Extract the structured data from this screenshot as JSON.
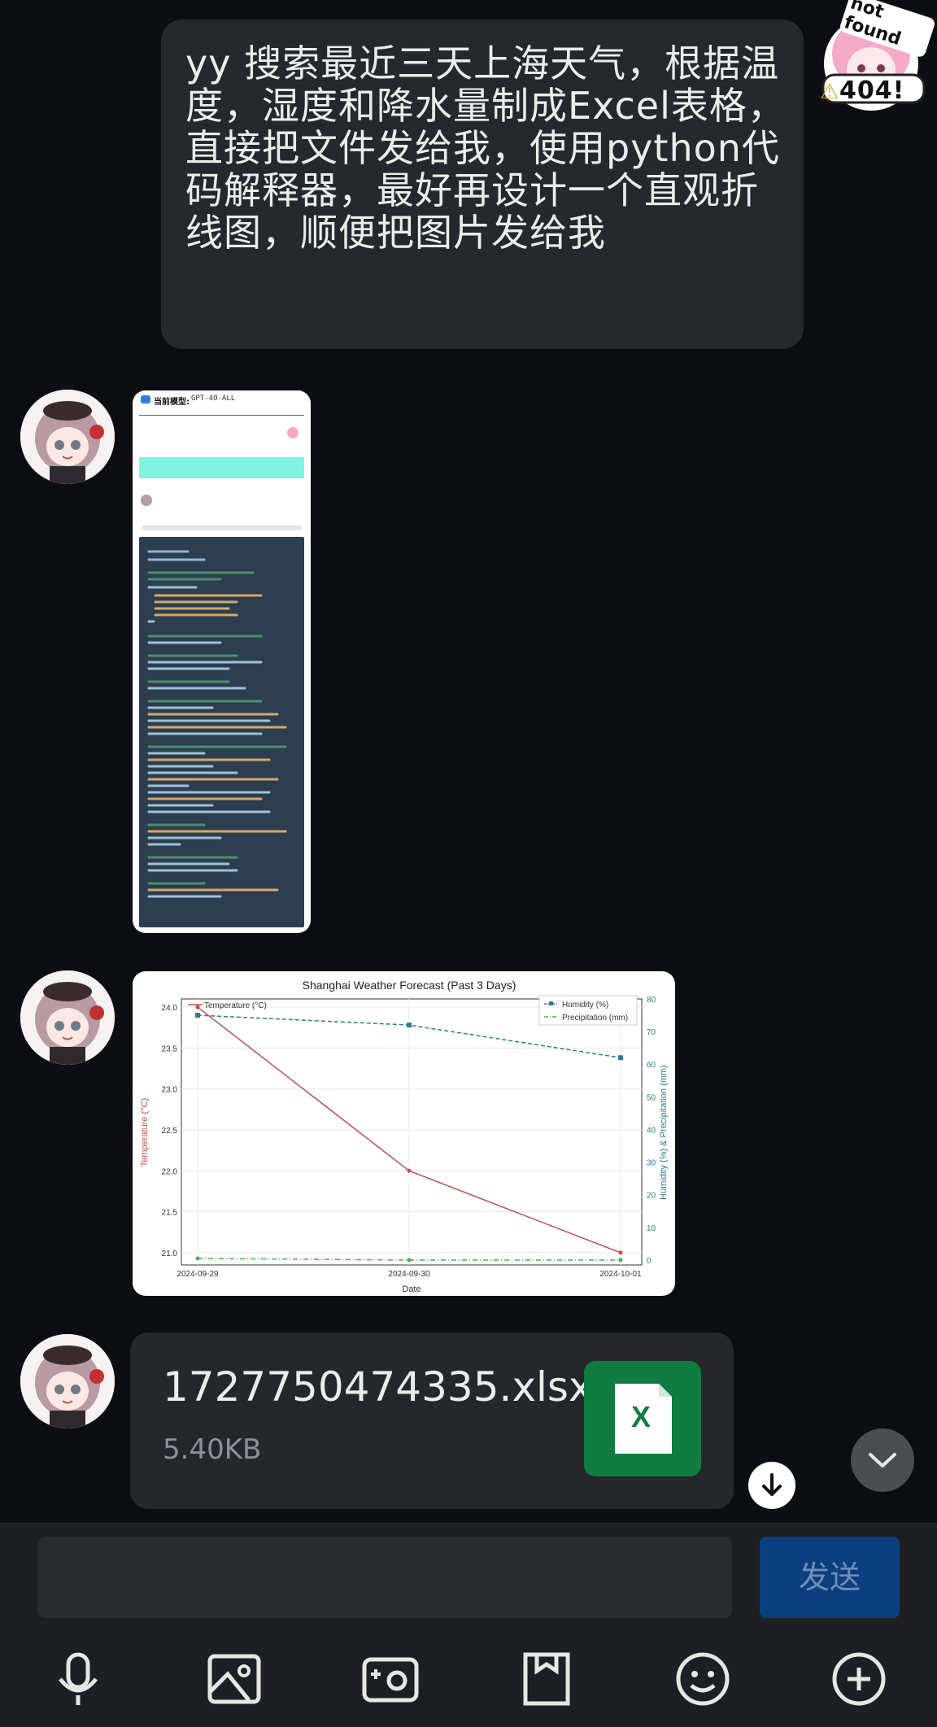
{
  "conversation": {
    "user_message": "yy 搜索最近三天上海天气，根据温度，湿度和降水量制成Excel表格，直接把文件发给我，使用python代码解释器，最好再设计一个直观折线图，顺便把图片发给我",
    "user_avatar": {
      "badge_top": "not found",
      "badge_bottom": "404!"
    },
    "screenshot": {
      "model_label": "当前模型:",
      "model_name": "GPT-4O-ALL"
    },
    "file": {
      "name": "1727750474335.xlsx",
      "size": "5.40KB",
      "icon": "X"
    }
  },
  "chart_data": {
    "type": "line",
    "title": "Shanghai Weather Forecast (Past 3 Days)",
    "xlabel": "Date",
    "ylabel": "Temperature (°C)",
    "y2label": "Humidity (%) & Precipitation (mm)",
    "categories": [
      "2024-09-29",
      "2024-09-30",
      "2024-10-01"
    ],
    "ylim": [
      20.85,
      24.1
    ],
    "y2lim": [
      -1.5,
      80
    ],
    "yticks": [
      "21.0",
      "21.5",
      "22.0",
      "22.5",
      "23.0",
      "23.5",
      "24.0"
    ],
    "y2ticks": [
      "0",
      "10",
      "20",
      "30",
      "40",
      "50",
      "60",
      "70",
      "80"
    ],
    "grid": true,
    "legend_left": "top-left",
    "legend_right": "top-right",
    "series": [
      {
        "name": "Temperature (°C)",
        "axis": "left",
        "values": [
          24.0,
          22.0,
          21.0
        ],
        "color": "#c0504d",
        "style": "solid"
      },
      {
        "name": "Humidity (%)",
        "axis": "right",
        "values": [
          75,
          72,
          62
        ],
        "color": "#2e7d8c",
        "style": "dashed"
      },
      {
        "name": "Precipitation (mm)",
        "axis": "right",
        "values": [
          0.5,
          0.0,
          0.0
        ],
        "color": "#4caf50",
        "style": "dashdot"
      }
    ]
  },
  "composer": {
    "input_value": "",
    "send_label": "发送"
  },
  "toolbar": {
    "icons": [
      "microphone-icon",
      "image-icon",
      "camera-icon",
      "file-icon",
      "emoji-icon",
      "plus-icon"
    ]
  },
  "colors": {
    "excel_green": "#107c41",
    "send_blue": "#0c3f7f",
    "bubble": "#26282c"
  }
}
